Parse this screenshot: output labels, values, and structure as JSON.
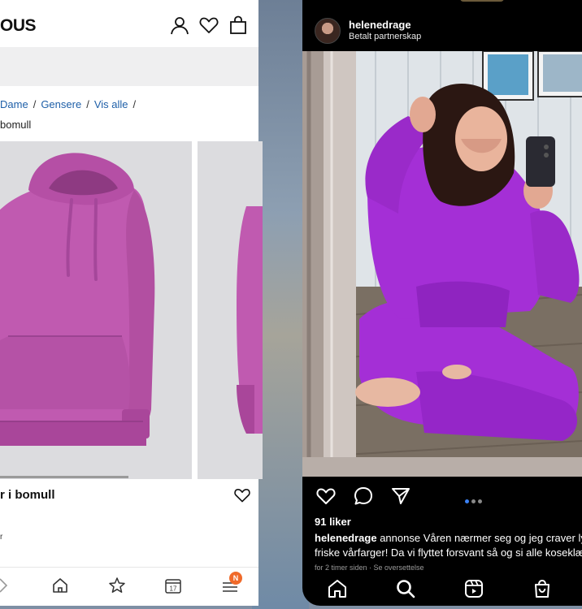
{
  "shop": {
    "logo_text": "OUS",
    "breadcrumbs": [
      "Dame",
      "Gensere",
      "Vis alle"
    ],
    "breadcrumb_current": "bomull",
    "product_title": "r i bomull",
    "product_sub": "r",
    "nav_badge": "N",
    "product_color": "#c05ab0"
  },
  "instagram": {
    "username": "helenedrage",
    "sponsored_label": "Betalt partnerskap",
    "likes": "91 liker",
    "caption_user": "helenedrage",
    "caption_line1": " annonse Våren nærmer seg og jeg craver lys,",
    "caption_line2": "friske vårfarger! Da vi flyttet forsvant så og si alle koseklær",
    "timestamp": "for 2 timer siden · Se oversettelse",
    "outfit_color": "#a42fd6"
  }
}
